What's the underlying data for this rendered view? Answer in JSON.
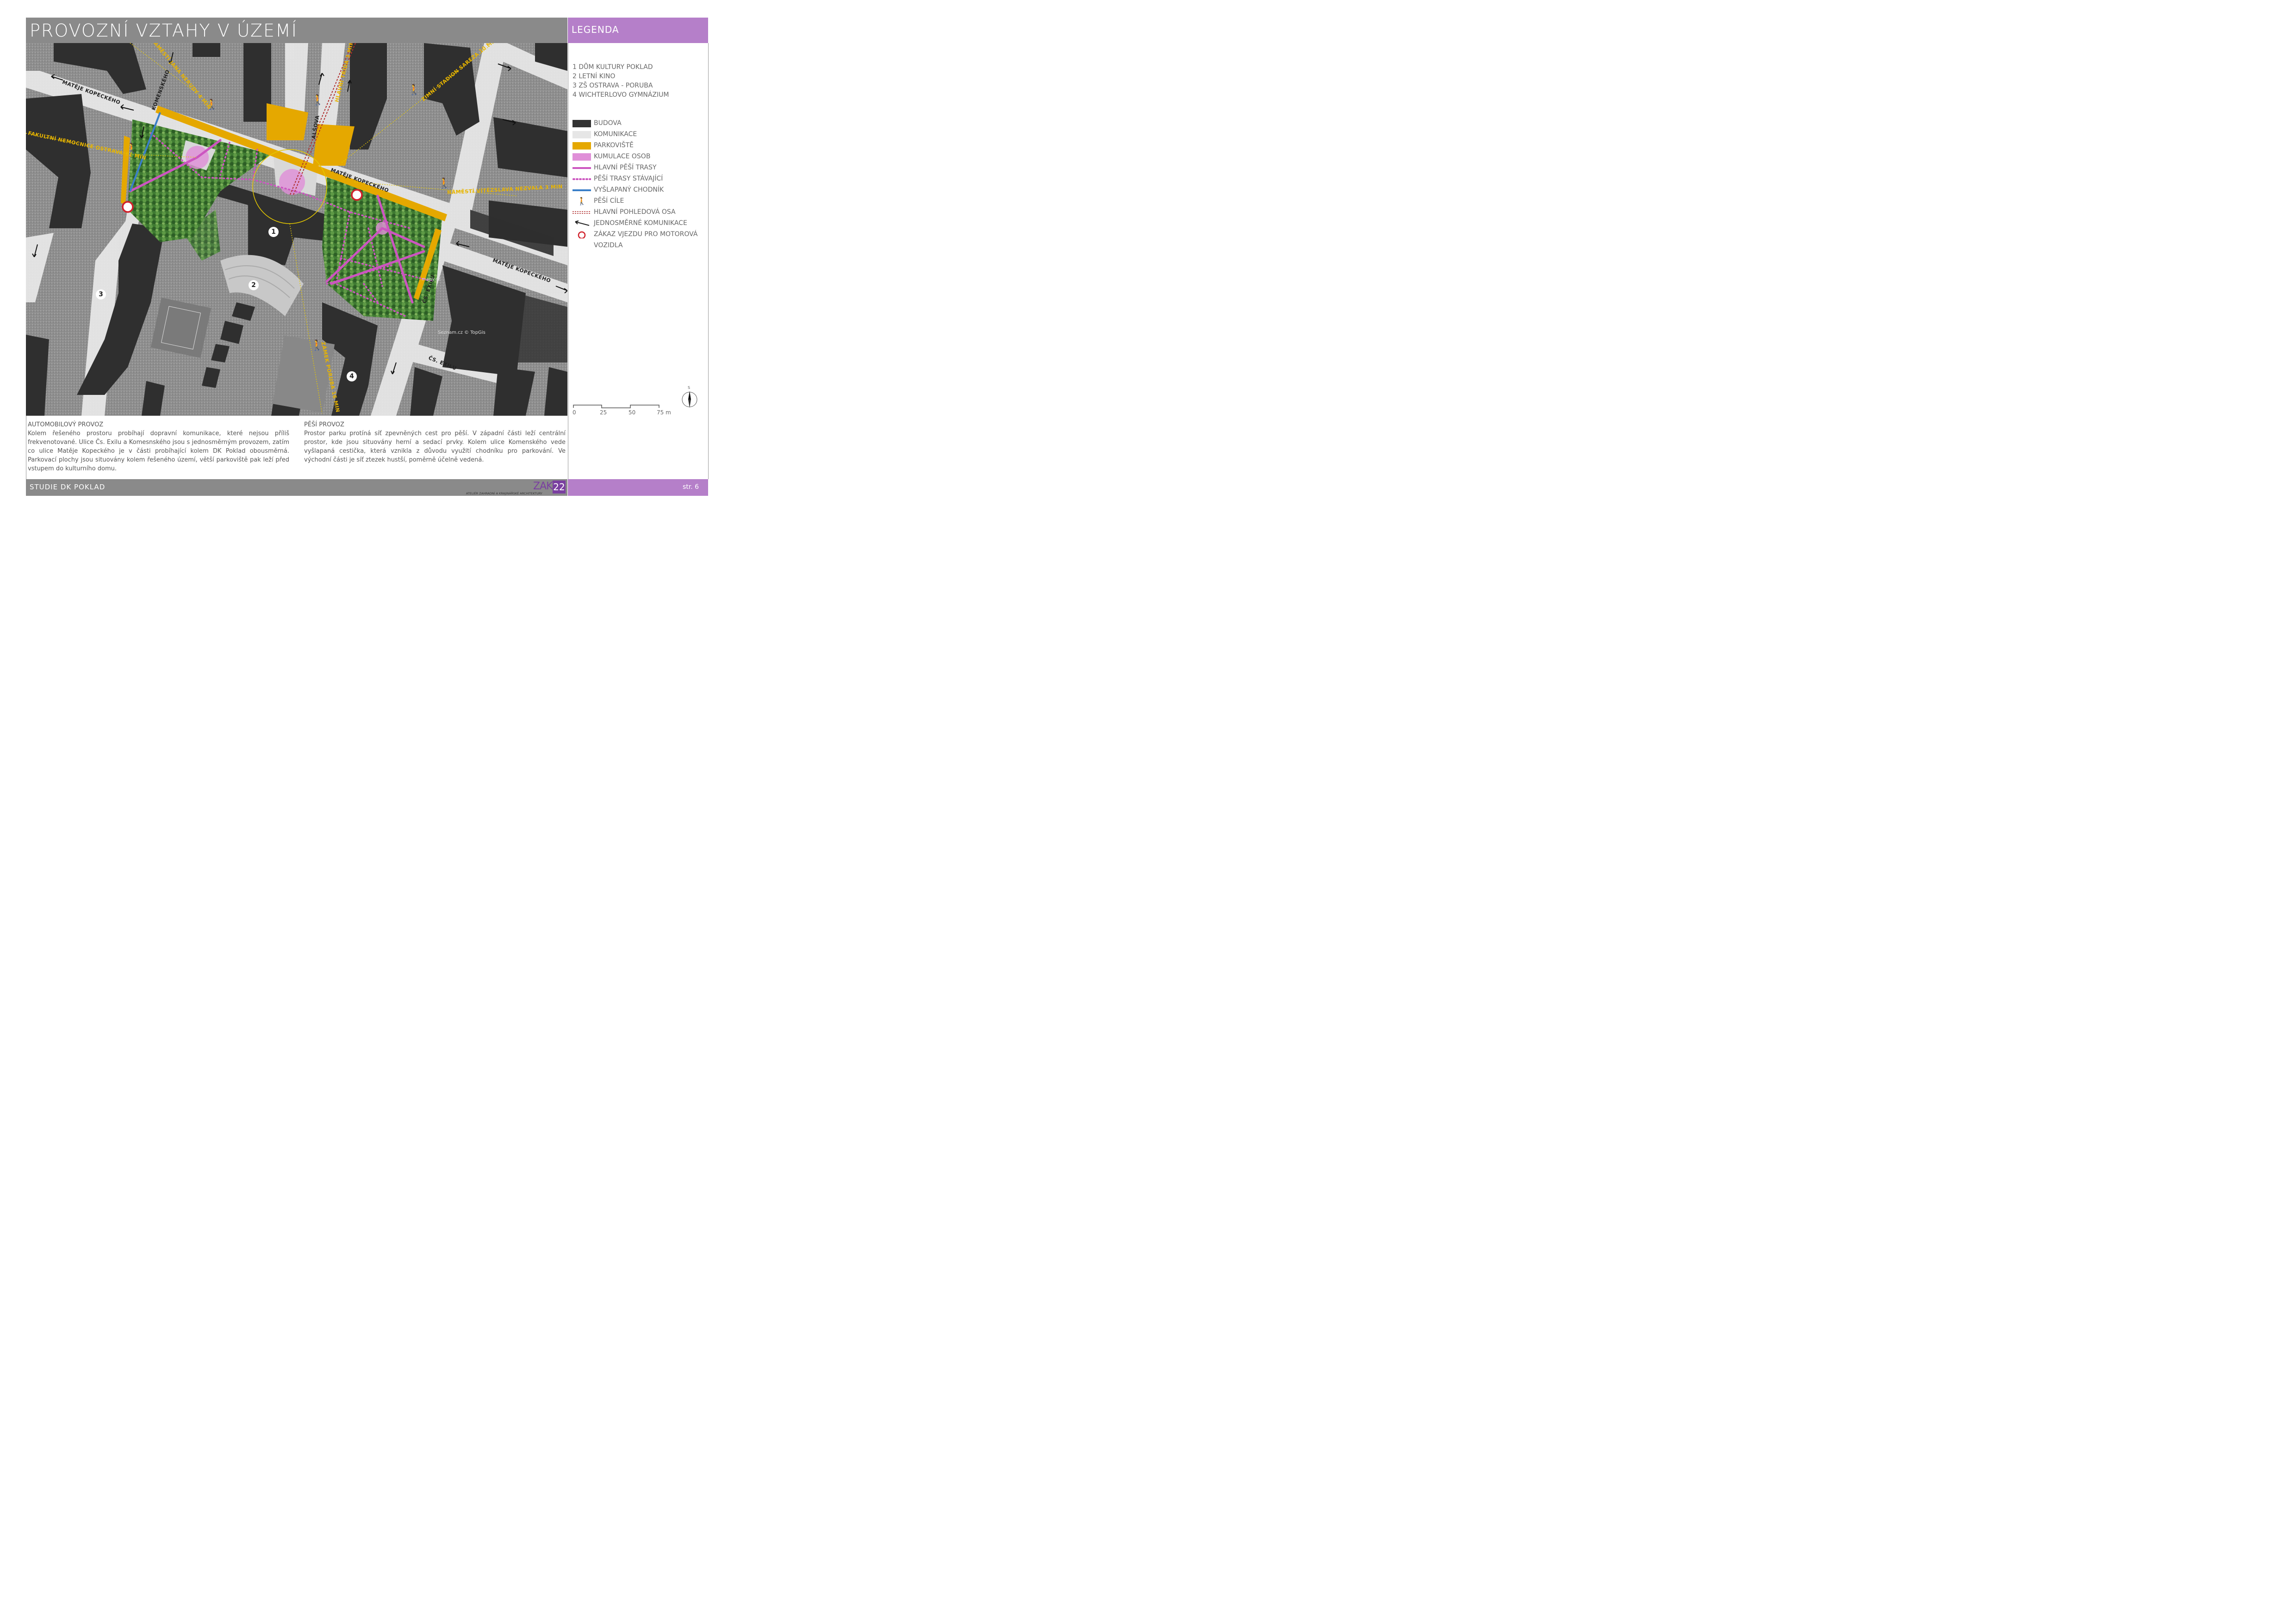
{
  "title": "PROVOZNÍ VZTAHY V ÚZEMÍ",
  "legend_title": "LEGENDA",
  "places": [
    "1 DŮM KULTURY POKLAD",
    "2 LETNÍ KINO",
    "3 ZŠ OSTRAVA - PORUBA",
    "4 WICHTERLOVO GYMNÁZIUM"
  ],
  "legend": [
    {
      "label": "BUDOVA",
      "swatch": "building",
      "color": "#333333"
    },
    {
      "label": "KOMUNIKACE",
      "swatch": "road",
      "color": "#e6e6e6"
    },
    {
      "label": "PARKOVIŠTĚ",
      "swatch": "parking",
      "color": "#e5a800"
    },
    {
      "label": "KUMULACE OSOB",
      "swatch": "crowd",
      "color": "#e08fd8"
    },
    {
      "label": "HLAVNÍ PĚŠÍ TRASY",
      "swatch": "main-path",
      "color": "#cc55c0"
    },
    {
      "label": "PĚŠÍ TRASY STÁVAJÍCÍ",
      "swatch": "existing-path",
      "color": "#cc55c0"
    },
    {
      "label": "VYŠLAPANÝ CHODNÍK",
      "swatch": "trodden-path",
      "color": "#3a7fc8"
    },
    {
      "label": "PĚŠÍ CÍLE",
      "swatch": "pedestrian-icon",
      "color": "#e5a800"
    },
    {
      "label": "HLAVNÍ POHLEDOVÁ OSA",
      "swatch": "view-axis",
      "color": "#b03030"
    },
    {
      "label": "JEDNOSMĚRNÉ KOMUNIKACE",
      "swatch": "one-way-arrow",
      "color": "#222222"
    },
    {
      "label": "ZÁKAZ VJEZDU PRO MOTOROVÁ",
      "swatch": "no-entry",
      "color": "#d0202a"
    },
    {
      "label": "VOZIDLA",
      "swatch": "none",
      "color": "#666666"
    }
  ],
  "scale": {
    "labels": [
      "0",
      "25",
      "50",
      "75 m"
    ]
  },
  "compass": {
    "label": "S"
  },
  "map": {
    "streets": [
      "MATĚJE KOPECKÉHO",
      "KOMENSKÉHO",
      "MATĚJE KOPECKÉHO",
      "ALŠOVA",
      "MATĚJE KOPECKÉHO",
      "ČS. EXILU",
      "ČS. EXILU"
    ],
    "destinations": [
      "NÁMĚSTÍ JANA NERUDY 4 MIN",
      "HLAVNÍ TŘÍDA 3 MIN",
      "ZIMNÍ STADION SAREZA 10 MIN",
      "FAKULTNÍ NEMOCNICE OSTRAVA 11 MIN",
      "NÁMĚSTÍ VÍTĚZSLAVA NEZVALA 3 MIN",
      "ZÁMEK PORUBA 16 MIN"
    ],
    "numbers": [
      "1",
      "2",
      "3",
      "4"
    ],
    "watermarks": [
      "Seznam.cz © TopGis",
      "mapy.cz"
    ]
  },
  "text": {
    "auto_heading": "AUTOMOBILOVÝ PROVOZ",
    "auto_body": "Kolem řešeného prostoru probíhají dopravní komunikace, které nejsou příliš frekvenotované. Ulice Čs. Exilu a Komesnského jsou s jednosměrným provozem, zatím co ulice Matěje Kopeckého je v části probíhající kolem DK Poklad obousměrná. Parkovací plochy jsou situovány kolem řešeného území, větší parkoviště pak leží před vstupem do kulturního domu.",
    "ped_heading": "PĚŠÍ PROVOZ",
    "ped_body": "Prostor parku protíná síť zpevněných cest pro pěší. V západní části leží centrální prostor, kde jsou situovány herní a sedací prvky. Kolem ulice Komenského vede vyšlapaná cestička, která vznikla z důvodu využití chodníku pro parkování. Ve východní části je síť ztezek hustší, poměrně účelně vedená."
  },
  "footer": {
    "studie": "STUDIE DK POKLAD",
    "logo_text": "ZAKA",
    "logo_num": "22",
    "logo_sub": "ATELIÉR ZAHRADNÍ A KRAJINÁŘSKÉ ARCHITEKTURY",
    "page": "str. 6"
  }
}
